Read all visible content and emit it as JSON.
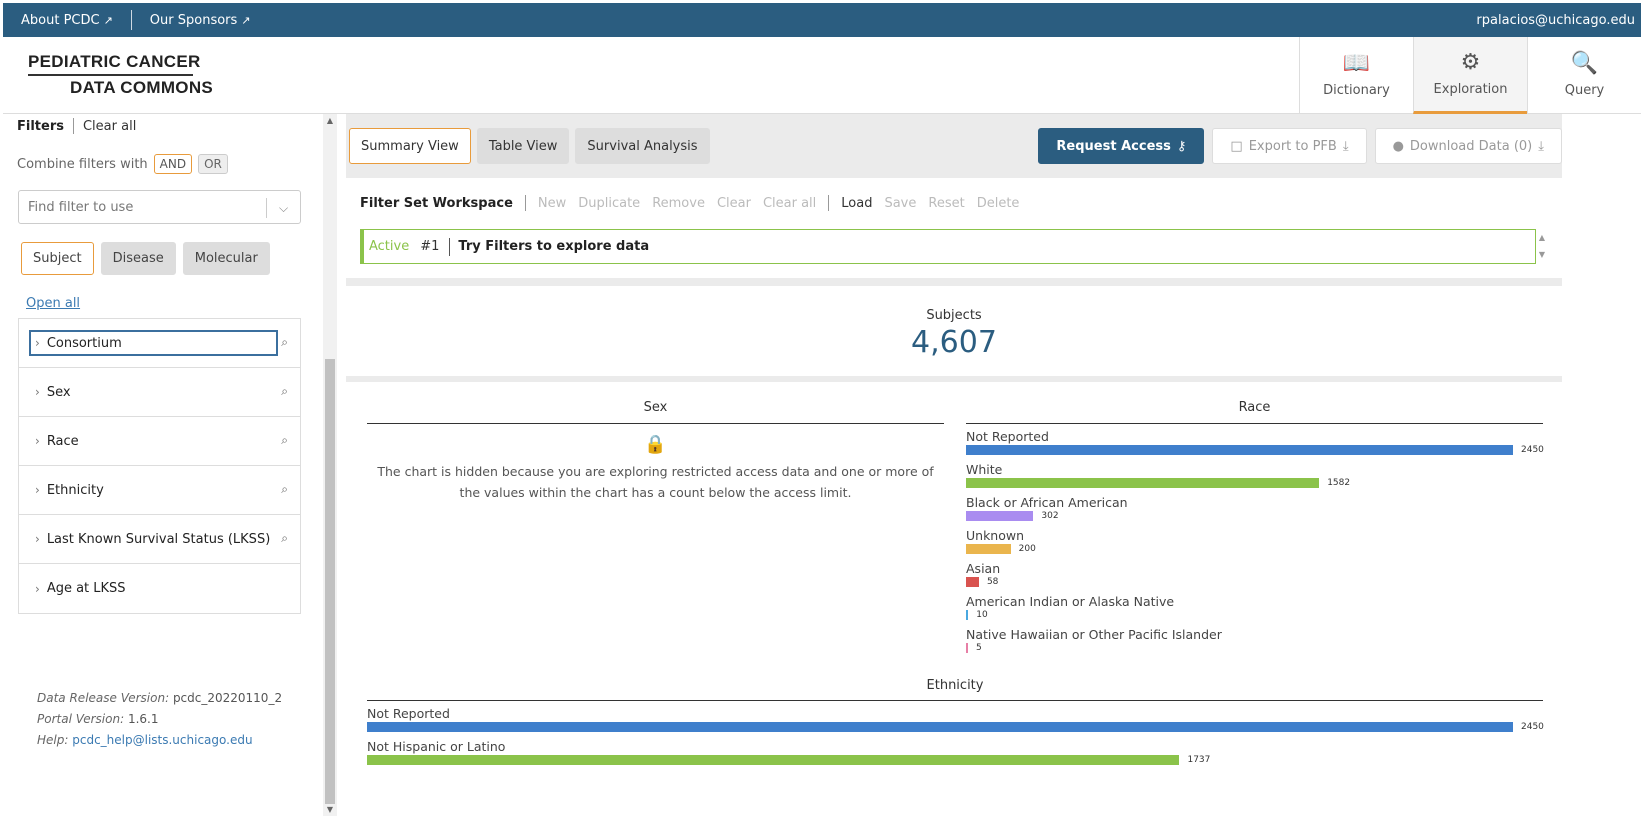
{
  "topbar": {
    "about": "About PCDC",
    "sponsors": "Our Sponsors",
    "user": "rpalacios@uchicago.edu"
  },
  "header": {
    "logo_line1": "PEDIATRIC CANCER",
    "logo_line2": "DATA COMMONS",
    "nav": [
      {
        "label": "Dictionary",
        "icon": "book-icon"
      },
      {
        "label": "Exploration",
        "icon": "exploration-icon"
      },
      {
        "label": "Query",
        "icon": "query-icon"
      }
    ]
  },
  "sidebar": {
    "filters_label": "Filters",
    "clear_all": "Clear all",
    "combine_label": "Combine filters with",
    "and": "AND",
    "or": "OR",
    "find_placeholder": "Find filter to use",
    "tabs": [
      "Subject",
      "Disease",
      "Molecular"
    ],
    "open_all": "Open all",
    "filters": [
      "Consortium",
      "Sex",
      "Race",
      "Ethnicity",
      "Last Known Survival Status (LKSS)",
      "Age at LKSS"
    ],
    "release_label": "Data Release Version:",
    "release_value": "pcdc_20220110_2",
    "portal_label": "Portal Version:",
    "portal_value": "1.6.1",
    "help_label": "Help:",
    "help_value": "pcdc_help@lists.uchicago.edu"
  },
  "main": {
    "view_tabs": [
      "Summary View",
      "Table View",
      "Survival Analysis"
    ],
    "request_access": "Request Access",
    "export": "Export to PFB",
    "download": "Download Data (0)",
    "workspace": {
      "title": "Filter Set Workspace",
      "actions_disabled_1": [
        "New",
        "Duplicate",
        "Remove",
        "Clear",
        "Clear all"
      ],
      "load": "Load",
      "actions_disabled_2": [
        "Save",
        "Reset",
        "Delete"
      ],
      "active": "Active",
      "num": "#1",
      "text": "Try Filters to explore data"
    },
    "subjects_label": "Subjects",
    "subjects_value": "4,607",
    "sex_title": "Sex",
    "sex_hidden_msg": "The chart is hidden because you are exploring restricted access data and one or more of the values within the chart has a count below the access limit.",
    "race_title": "Race",
    "ethnicity_title": "Ethnicity"
  },
  "chart_data": [
    {
      "type": "bar",
      "title": "Race",
      "categories": [
        "Not Reported",
        "White",
        "Black or African American",
        "Unknown",
        "Asian",
        "American Indian or Alaska Native",
        "Native Hawaiian or Other Pacific Islander"
      ],
      "values": [
        2450,
        1582,
        302,
        200,
        58,
        10,
        5
      ],
      "colors": [
        "#3f7fcc",
        "#8bc34a",
        "#a98cf0",
        "#eab54d",
        "#d9534f",
        "#4aa8e0",
        "#e77fa6"
      ]
    },
    {
      "type": "bar",
      "title": "Ethnicity",
      "categories": [
        "Not Reported",
        "Not Hispanic or Latino"
      ],
      "values": [
        2450,
        1737
      ],
      "colors": [
        "#3f7fcc",
        "#8bc34a"
      ]
    }
  ]
}
